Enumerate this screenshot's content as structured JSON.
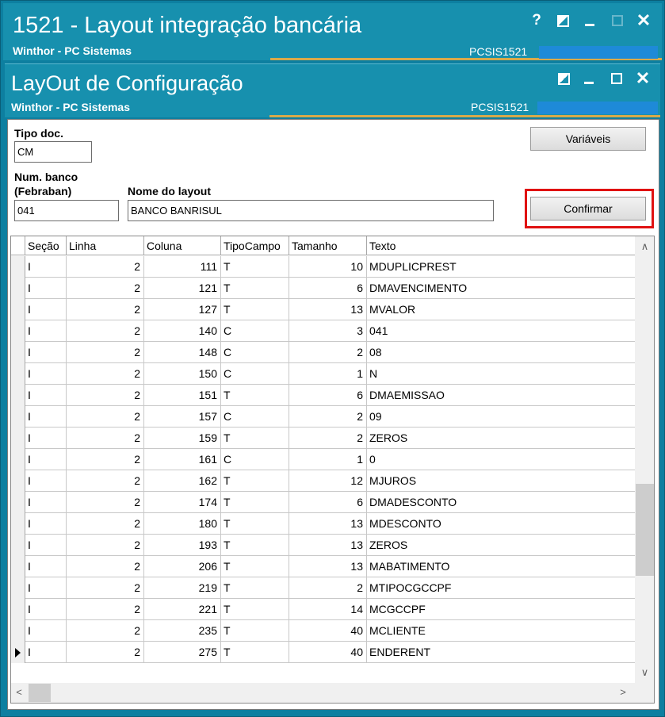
{
  "app_window": {
    "title": "1521 - Layout integração bancária",
    "subtitle": "Winthor - PC Sistemas",
    "code": "PCSIS1521",
    "help_label": "?"
  },
  "dialog": {
    "title": "LayOut de Configuração",
    "subtitle": "Winthor - PC Sistemas",
    "code": "PCSIS1521"
  },
  "form": {
    "tipo_doc_label": "Tipo doc.",
    "tipo_doc_value": "CM",
    "num_banco_label_1": "Num. banco",
    "num_banco_label_2": "(Febraban)",
    "num_banco_value": "041",
    "nome_layout_label": "Nome do layout",
    "nome_layout_value": "BANCO BANRISUL",
    "variaveis_label": "Variáveis",
    "confirmar_label": "Confirmar"
  },
  "grid": {
    "columns": [
      "Seção",
      "Linha",
      "Coluna",
      "TipoCampo",
      "Tamanho",
      "Texto"
    ],
    "rows": [
      [
        "I",
        "2",
        "111",
        "T",
        "10",
        "MDUPLICPREST"
      ],
      [
        "I",
        "2",
        "121",
        "T",
        "6",
        "DMAVENCIMENTO"
      ],
      [
        "I",
        "2",
        "127",
        "T",
        "13",
        "MVALOR"
      ],
      [
        "I",
        "2",
        "140",
        "C",
        "3",
        "041"
      ],
      [
        "I",
        "2",
        "148",
        "C",
        "2",
        "08"
      ],
      [
        "I",
        "2",
        "150",
        "C",
        "1",
        "N"
      ],
      [
        "I",
        "2",
        "151",
        "T",
        "6",
        "DMAEMISSAO"
      ],
      [
        "I",
        "2",
        "157",
        "C",
        "2",
        "09"
      ],
      [
        "I",
        "2",
        "159",
        "T",
        "2",
        "ZEROS"
      ],
      [
        "I",
        "2",
        "161",
        "C",
        "1",
        "0"
      ],
      [
        "I",
        "2",
        "162",
        "T",
        "12",
        "MJUROS"
      ],
      [
        "I",
        "2",
        "174",
        "T",
        "6",
        "DMADESCONTO"
      ],
      [
        "I",
        "2",
        "180",
        "T",
        "13",
        "MDESCONTO"
      ],
      [
        "I",
        "2",
        "193",
        "T",
        "13",
        "ZEROS"
      ],
      [
        "I",
        "2",
        "206",
        "T",
        "13",
        "MABATIMENTO"
      ],
      [
        "I",
        "2",
        "219",
        "T",
        "2",
        "MTIPOCGCCPF"
      ],
      [
        "I",
        "2",
        "221",
        "T",
        "14",
        "MCGCCPF"
      ],
      [
        "I",
        "2",
        "235",
        "T",
        "40",
        "MCLIENTE"
      ],
      [
        "I",
        "2",
        "275",
        "T",
        "40",
        "ENDERENT"
      ]
    ],
    "current_row_index": 18
  },
  "icons": {
    "help": "help-icon",
    "restore": "restore-icon",
    "minimize": "minimize-icon",
    "maximize": "maximize-icon",
    "close": "close-icon"
  },
  "colors": {
    "titlebar": "#1790ae",
    "accent_line": "#d8a94b",
    "highlight": "#e01212"
  }
}
